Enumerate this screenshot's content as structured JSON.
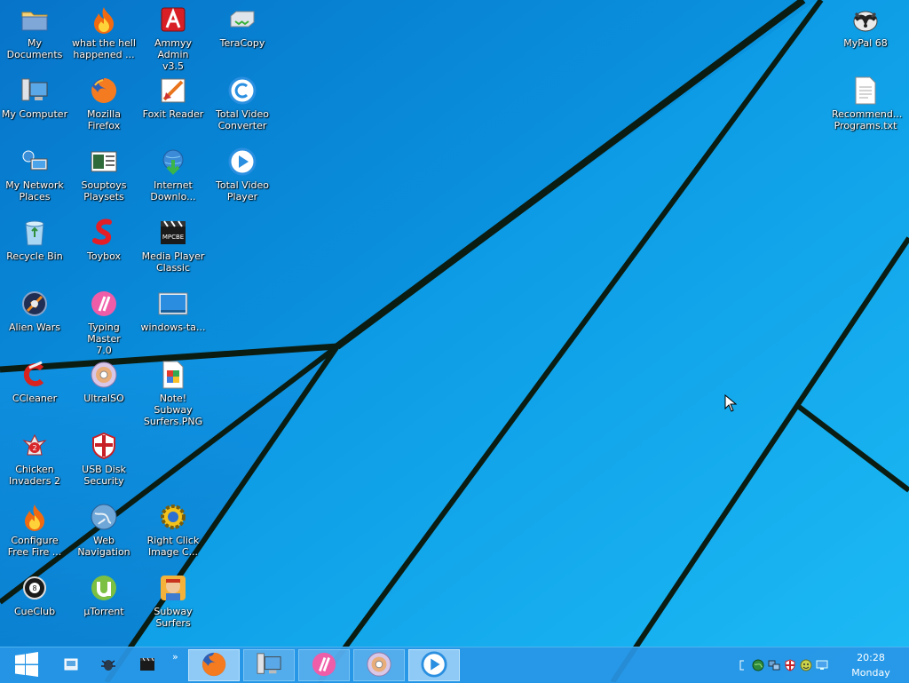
{
  "desktop": {
    "icons": [
      {
        "label": "My\nDocuments",
        "icon": "folder-icon"
      },
      {
        "label": "what the hell\nhappened ...",
        "icon": "fire-icon"
      },
      {
        "label": "Ammyy Admin\nv3.5",
        "icon": "ammyy-admin-icon"
      },
      {
        "label": "TeraCopy",
        "icon": "teracopy-icon"
      },
      {
        "label": "My Computer",
        "icon": "computer-icon"
      },
      {
        "label": "Mozilla\nFirefox",
        "icon": "firefox-icon"
      },
      {
        "label": "Foxit Reader",
        "icon": "foxit-reader-icon"
      },
      {
        "label": "Total Video\nConverter",
        "icon": "video-converter-icon"
      },
      {
        "label": "My Network\nPlaces",
        "icon": "network-places-icon"
      },
      {
        "label": "Souptoys\nPlaysets",
        "icon": "souptoys-icon"
      },
      {
        "label": "Internet\nDownlo...",
        "icon": "internet-download-manager-icon"
      },
      {
        "label": "Total Video\nPlayer",
        "icon": "video-player-icon"
      },
      {
        "label": "Recycle Bin",
        "icon": "recycle-bin-icon"
      },
      {
        "label": "Toybox",
        "icon": "toybox-icon"
      },
      {
        "label": "Media Player\nClassic",
        "icon": "media-player-classic-icon"
      },
      {
        "label": "Alien Wars",
        "icon": "alien-wars-icon"
      },
      {
        "label": "Typing Master\n7.0",
        "icon": "typing-master-icon"
      },
      {
        "label": "windows-ta...",
        "icon": "image-file-icon"
      },
      {
        "label": "CCleaner",
        "icon": "ccleaner-icon"
      },
      {
        "label": "UltraISO",
        "icon": "ultraiso-icon"
      },
      {
        "label": "Note! Subway\nSurfers.PNG",
        "icon": "png-file-icon"
      },
      {
        "label": "Chicken\nInvaders 2",
        "icon": "chicken-invaders-icon"
      },
      {
        "label": "USB Disk\nSecurity",
        "icon": "usb-disk-security-icon"
      },
      {
        "label": "Configure\nFree Fire ...",
        "icon": "fire-icon"
      },
      {
        "label": "Web\nNavigation",
        "icon": "globe-icon"
      },
      {
        "label": "Right Click\nImage C...",
        "icon": "image-converter-icon"
      },
      {
        "label": "CueClub",
        "icon": "cueclub-icon"
      },
      {
        "label": "µTorrent",
        "icon": "utorrent-icon"
      },
      {
        "label": "Subway\nSurfers",
        "icon": "subway-surfers-icon"
      },
      {
        "label": "MyPal 68",
        "icon": "mypal-icon"
      },
      {
        "label": "Recommend...\nPrograms.txt",
        "icon": "text-file-icon"
      }
    ]
  },
  "taskbar": {
    "start_icon": "windows-start-icon",
    "quick_launch": [
      "show-desktop-icon",
      "bug-icon",
      "media-player-classic-icon"
    ],
    "chevron": "»",
    "buttons": [
      {
        "icon": "firefox-icon",
        "active": true
      },
      {
        "icon": "computer-icon",
        "active": false
      },
      {
        "icon": "typing-master-icon",
        "active": false
      },
      {
        "icon": "ultraiso-icon",
        "active": false
      },
      {
        "icon": "video-player-icon",
        "active": true
      }
    ],
    "tray_icons": [
      "tray-bracket-icon",
      "network-globe-icon",
      "network-icon",
      "usb-security-icon",
      "smiley-icon",
      "monitor-icon"
    ],
    "clock": {
      "time": "20:28",
      "day": "Monday"
    }
  },
  "colors": {
    "wallpaper_top": "#0a86d6",
    "wallpaper_bottom": "#16b8f4",
    "wallpaper_lines": "#0b1c12",
    "taskbar": "#2896e6"
  }
}
